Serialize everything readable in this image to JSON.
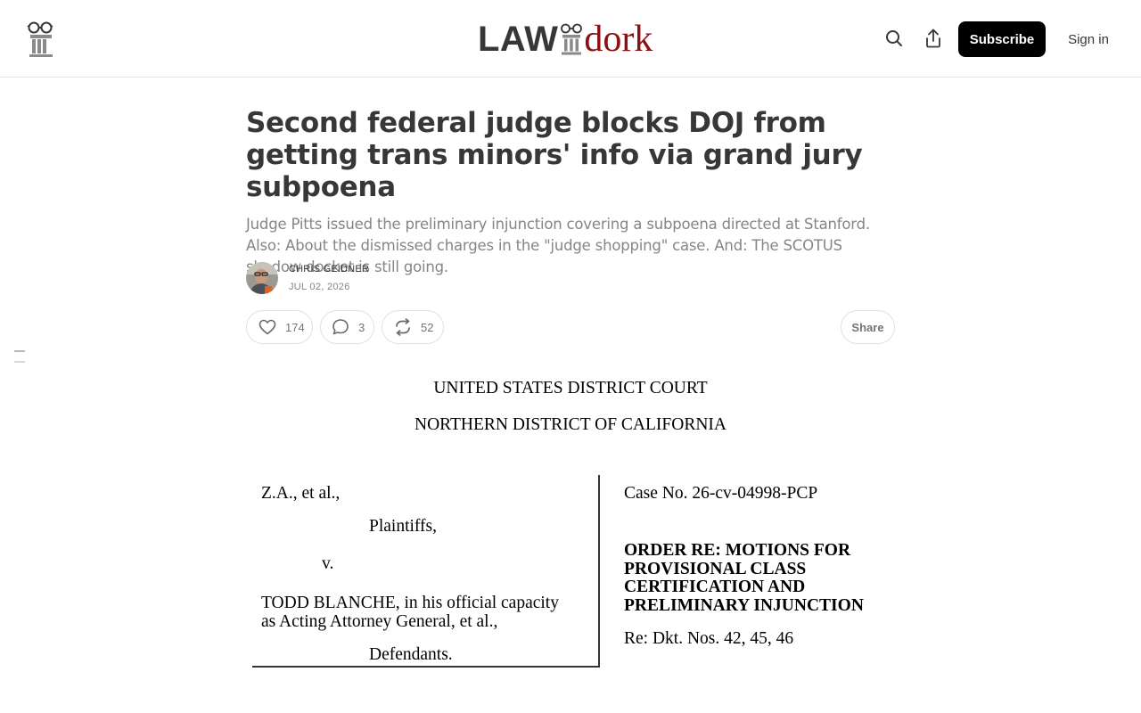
{
  "header": {
    "masthead_left": "LAW",
    "masthead_right": "dork",
    "brand_color": "#8b0f14",
    "subscribe_label": "Subscribe",
    "signin_label": "Sign in",
    "icons": [
      "site-logo-icon",
      "search-icon",
      "share-upload-icon",
      "table-of-contents-icon"
    ]
  },
  "post": {
    "title": "Second federal judge blocks DOJ from getting trans minors' info via grand jury subpoena",
    "subtitle": "Judge Pitts issued the preliminary injunction covering a subpoena directed at Stanford. Also: About the dismissed charges in the \"judge shopping\" case. And: The SCOTUS shadow docket is still going.",
    "author": "CHRIS GEIDNER",
    "date": "JUL 02, 2026"
  },
  "actions": {
    "likes": "174",
    "comments": "3",
    "restacks": "52",
    "share_label": "Share",
    "icons": [
      "heart-icon",
      "comment-icon",
      "restack-icon"
    ]
  },
  "court_document": {
    "court": "UNITED STATES DISTRICT COURT",
    "district": "NORTHERN DISTRICT OF CALIFORNIA",
    "plaintiff": "Z.A., et al.,",
    "plaintiffs_label": "Plaintiffs,",
    "versus": "v.",
    "defendant_line1": "TODD BLANCHE, in his official capacity",
    "defendant_line2": "as Acting Attorney General, et al.,",
    "defendants_label": "Defendants.",
    "case_number": "Case No.  26-cv-04998-PCP",
    "order_line1": "ORDER RE: MOTIONS FOR",
    "order_line2": "PROVISIONAL CLASS",
    "order_line3": "CERTIFICATION AND",
    "order_line4": "PRELIMINARY INJUNCTION",
    "docket": "Re: Dkt. Nos. 42, 45, 46"
  }
}
